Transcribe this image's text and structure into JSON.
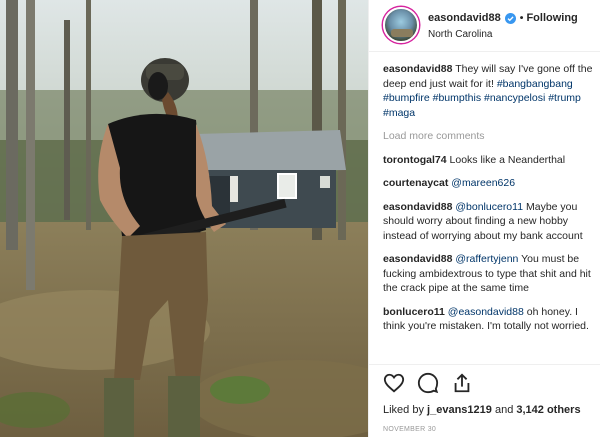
{
  "post": {
    "username": "easondavid88",
    "follow_separator": "•",
    "follow_label": "Following",
    "location": "North Carolina",
    "caption": {
      "username": "easondavid88",
      "text": "They will say I've gone off the deep end just wait for it!",
      "hashtags": [
        "#bangbangbang",
        "#bumpfire",
        "#bumpthis",
        "#nancypelosi",
        "#trump",
        "#maga"
      ]
    },
    "load_more_label": "Load more comments",
    "comments": [
      {
        "username": "torontogal74",
        "mention": "",
        "text": "Looks like a Neanderthal"
      },
      {
        "username": "courtenaycat",
        "mention": "@mareen626",
        "text": ""
      },
      {
        "username": "easondavid88",
        "mention": "@bonlucero11",
        "text": "Maybe you should worry about finding a new hobby instead of worrying about my bank account"
      },
      {
        "username": "easondavid88",
        "mention": "@raffertyjenn",
        "text": "You must be fucking ambidextrous to type that shit and hit the crack pipe at the same time"
      },
      {
        "username": "bonlucero11",
        "mention": "@easondavid88",
        "text": "oh honey. I think you're mistaken. I'm totally not worried."
      }
    ],
    "likes": {
      "prefix": "Liked by",
      "first_user": "j_evans1219",
      "joiner": "and",
      "count": "3,142 others"
    },
    "date": "NOVEMBER 30",
    "icons": [
      "heart-icon",
      "comment-icon",
      "share-icon",
      "verified-badge-icon"
    ],
    "colors": {
      "link": "#003569",
      "muted": "#999999",
      "verified": "#3897f0"
    }
  }
}
